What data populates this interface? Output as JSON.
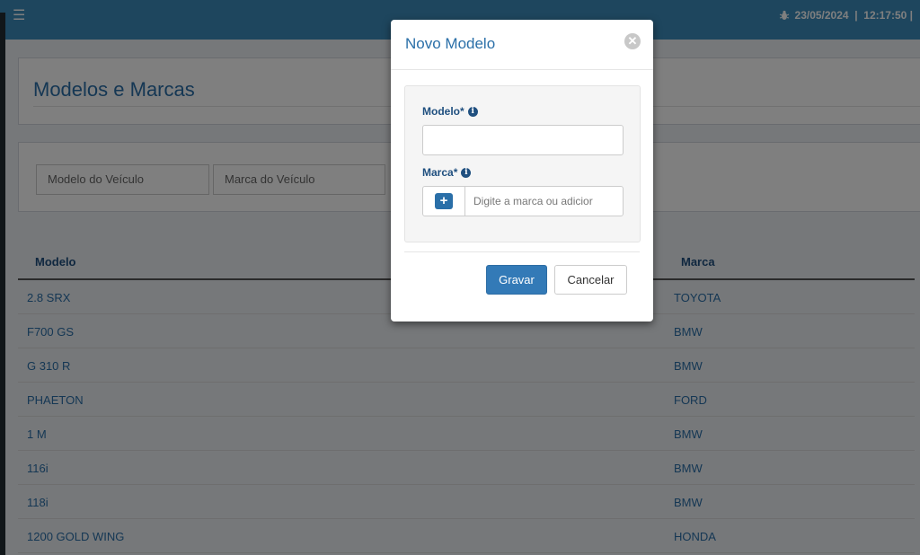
{
  "topbar": {
    "datetime": "23/05/2024  |  12:17:50 |"
  },
  "page": {
    "title": "Modelos e Marcas"
  },
  "filters": {
    "modelo_placeholder": "Modelo do Veículo",
    "marca_placeholder": "Marca do Veículo"
  },
  "table": {
    "headers": {
      "modelo": "Modelo",
      "marca": "Marca"
    },
    "rows": [
      {
        "modelo": "2.8 SRX",
        "marca": "TOYOTA"
      },
      {
        "modelo": "F700 GS",
        "marca": "BMW"
      },
      {
        "modelo": "G 310 R",
        "marca": "BMW"
      },
      {
        "modelo": "PHAETON",
        "marca": "FORD"
      },
      {
        "modelo": "1 M",
        "marca": "BMW"
      },
      {
        "modelo": "116i",
        "marca": "BMW"
      },
      {
        "modelo": "118i",
        "marca": "BMW"
      },
      {
        "modelo": "1200 GOLD WING",
        "marca": "HONDA"
      }
    ]
  },
  "modal": {
    "title": "Novo Modelo",
    "modelo_label": "Modelo*",
    "modelo_value": "",
    "marca_label": "Marca*",
    "marca_placeholder": "Digite a marca ou adicior",
    "save_label": "Gravar",
    "cancel_label": "Cancelar"
  },
  "colors": {
    "brand": "#3c8dbc",
    "primary_button": "#337ab7",
    "link_text": "#2a6fa8"
  }
}
